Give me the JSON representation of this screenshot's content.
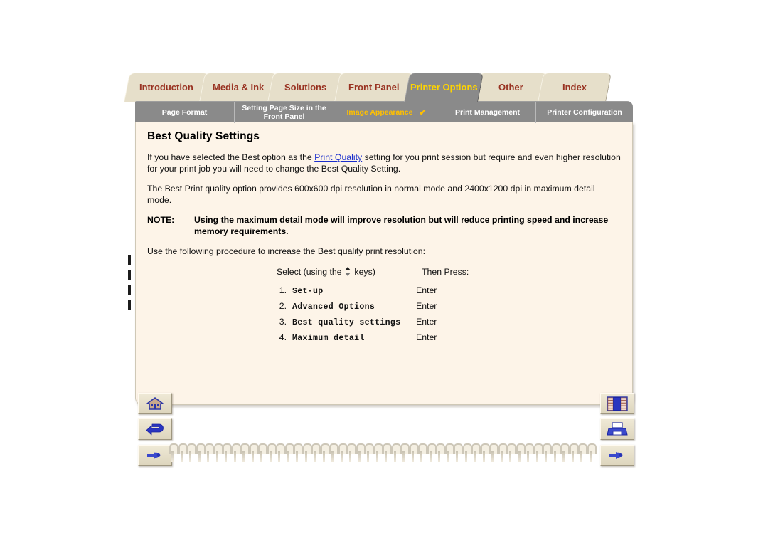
{
  "tabs": [
    {
      "label": "Introduction",
      "active": false
    },
    {
      "label": "Media & Ink",
      "active": false
    },
    {
      "label": "Solutions",
      "active": false
    },
    {
      "label": "Front Panel",
      "active": false
    },
    {
      "label": "Printer Options",
      "active": true
    },
    {
      "label": "Other",
      "active": false
    },
    {
      "label": "Index",
      "active": false
    }
  ],
  "subtabs": [
    {
      "label": "Page Format",
      "active": false,
      "check": ""
    },
    {
      "label": "Setting Page Size in the Front Panel",
      "active": false,
      "check": ""
    },
    {
      "label": "Image Appearance",
      "active": true,
      "check": "✔"
    },
    {
      "label": "Print Management",
      "active": false,
      "check": ""
    },
    {
      "label": "Printer Configuration",
      "active": false,
      "check": ""
    }
  ],
  "content": {
    "title": "Best Quality Settings",
    "para1_before": "If you have selected the Best option as the ",
    "para1_link": "Print Quality",
    "para1_after": " setting for you print session but require and even higher resolution for your print job you will need to change the Best Quality Setting.",
    "para2": "The Best Print quality option provides 600x600 dpi resolution in normal mode and 2400x1200 dpi in maximum detail mode.",
    "note_label": "NOTE:",
    "note_text": "Using the maximum detail mode will improve resolution but will reduce printing speed and increase memory requirements.",
    "para3": "Use the following procedure to increase the Best quality print resolution:"
  },
  "procedure": {
    "header_select_pre": "Select (using the ",
    "header_select_post": " keys)",
    "header_press": "Then Press:",
    "rows": [
      {
        "num": "1.",
        "command": "Set-up",
        "press": "Enter"
      },
      {
        "num": "2.",
        "command": "Advanced Options",
        "press": "Enter"
      },
      {
        "num": "3.",
        "command": "Best quality settings",
        "press": "Enter"
      },
      {
        "num": "4.",
        "command": "Maximum detail",
        "press": "Enter"
      }
    ]
  },
  "nav_left": [
    {
      "icon": "home-icon"
    },
    {
      "icon": "back-arrow-icon"
    },
    {
      "icon": "pointing-hand-icon"
    }
  ],
  "nav_right": [
    {
      "icon": "bookshelf-icon"
    },
    {
      "icon": "printer-icon"
    },
    {
      "icon": "pointing-hand-icon"
    }
  ],
  "colors": {
    "tab_inactive_bg": "#e6dfca",
    "tab_inactive_text": "#993322",
    "tab_active_bg": "#8a8a8a",
    "tab_active_text": "#ffd400",
    "subtab_text": "#ffffff",
    "subtab_active_text": "#ffc000",
    "page_bg": "#fdf4e8",
    "link": "#1a2ecc",
    "rule": "#93a889"
  }
}
